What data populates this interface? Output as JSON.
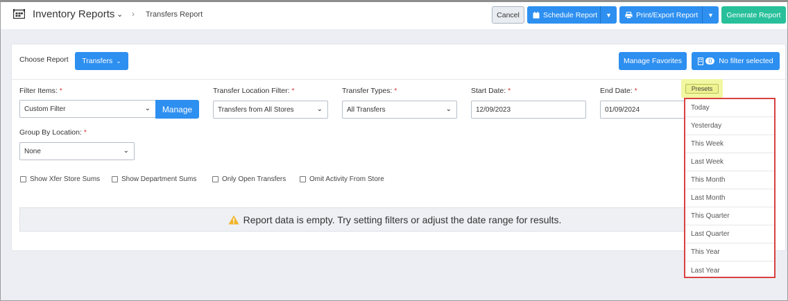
{
  "header": {
    "app_title": "Inventory Reports",
    "breadcrumb": "Transfers Report",
    "cancel_label": "Cancel",
    "schedule_label": "Schedule Report",
    "print_label": "Print/Export Report",
    "generate_label": "Generate Report"
  },
  "toolbar": {
    "choose_report_label": "Choose Report",
    "report_selected": "Transfers",
    "manage_favorites_label": "Manage Favorites",
    "filter_count": "0",
    "filter_status": "No filter selected"
  },
  "filters": {
    "filter_items_label": "Filter Items:",
    "filter_items_value": "Custom Filter",
    "manage_label": "Manage",
    "location_filter_label": "Transfer Location Filter:",
    "location_filter_value": "Transfers from All Stores",
    "transfer_types_label": "Transfer Types:",
    "transfer_types_value": "All Transfers",
    "start_date_label": "Start Date:",
    "start_date_value": "12/09/2023",
    "end_date_label": "End Date:",
    "end_date_value": "01/09/2024",
    "group_by_label": "Group By Location:",
    "group_by_value": "None",
    "required_mark": "*"
  },
  "checkboxes": [
    {
      "label": "Show Xfer Store Sums",
      "checked": false
    },
    {
      "label": "Show Department Sums",
      "checked": false
    },
    {
      "label": "Only Open Transfers",
      "checked": false
    },
    {
      "label": "Omit Activity From Store",
      "checked": false
    }
  ],
  "alert": {
    "message": "Report data is empty. Try setting filters or adjust the date range for results."
  },
  "presets": {
    "button_label": "Presets",
    "items": [
      "Today",
      "Yesterday",
      "This Week",
      "Last Week",
      "This Month",
      "Last Month",
      "This Quarter",
      "Last Quarter",
      "This Year",
      "Last Year"
    ]
  },
  "colors": {
    "primary": "#2d8ff0",
    "success": "#27c09a",
    "required": "#d9363e",
    "highlight": "#f2f7a2",
    "dropdown_border": "#d8403f"
  }
}
